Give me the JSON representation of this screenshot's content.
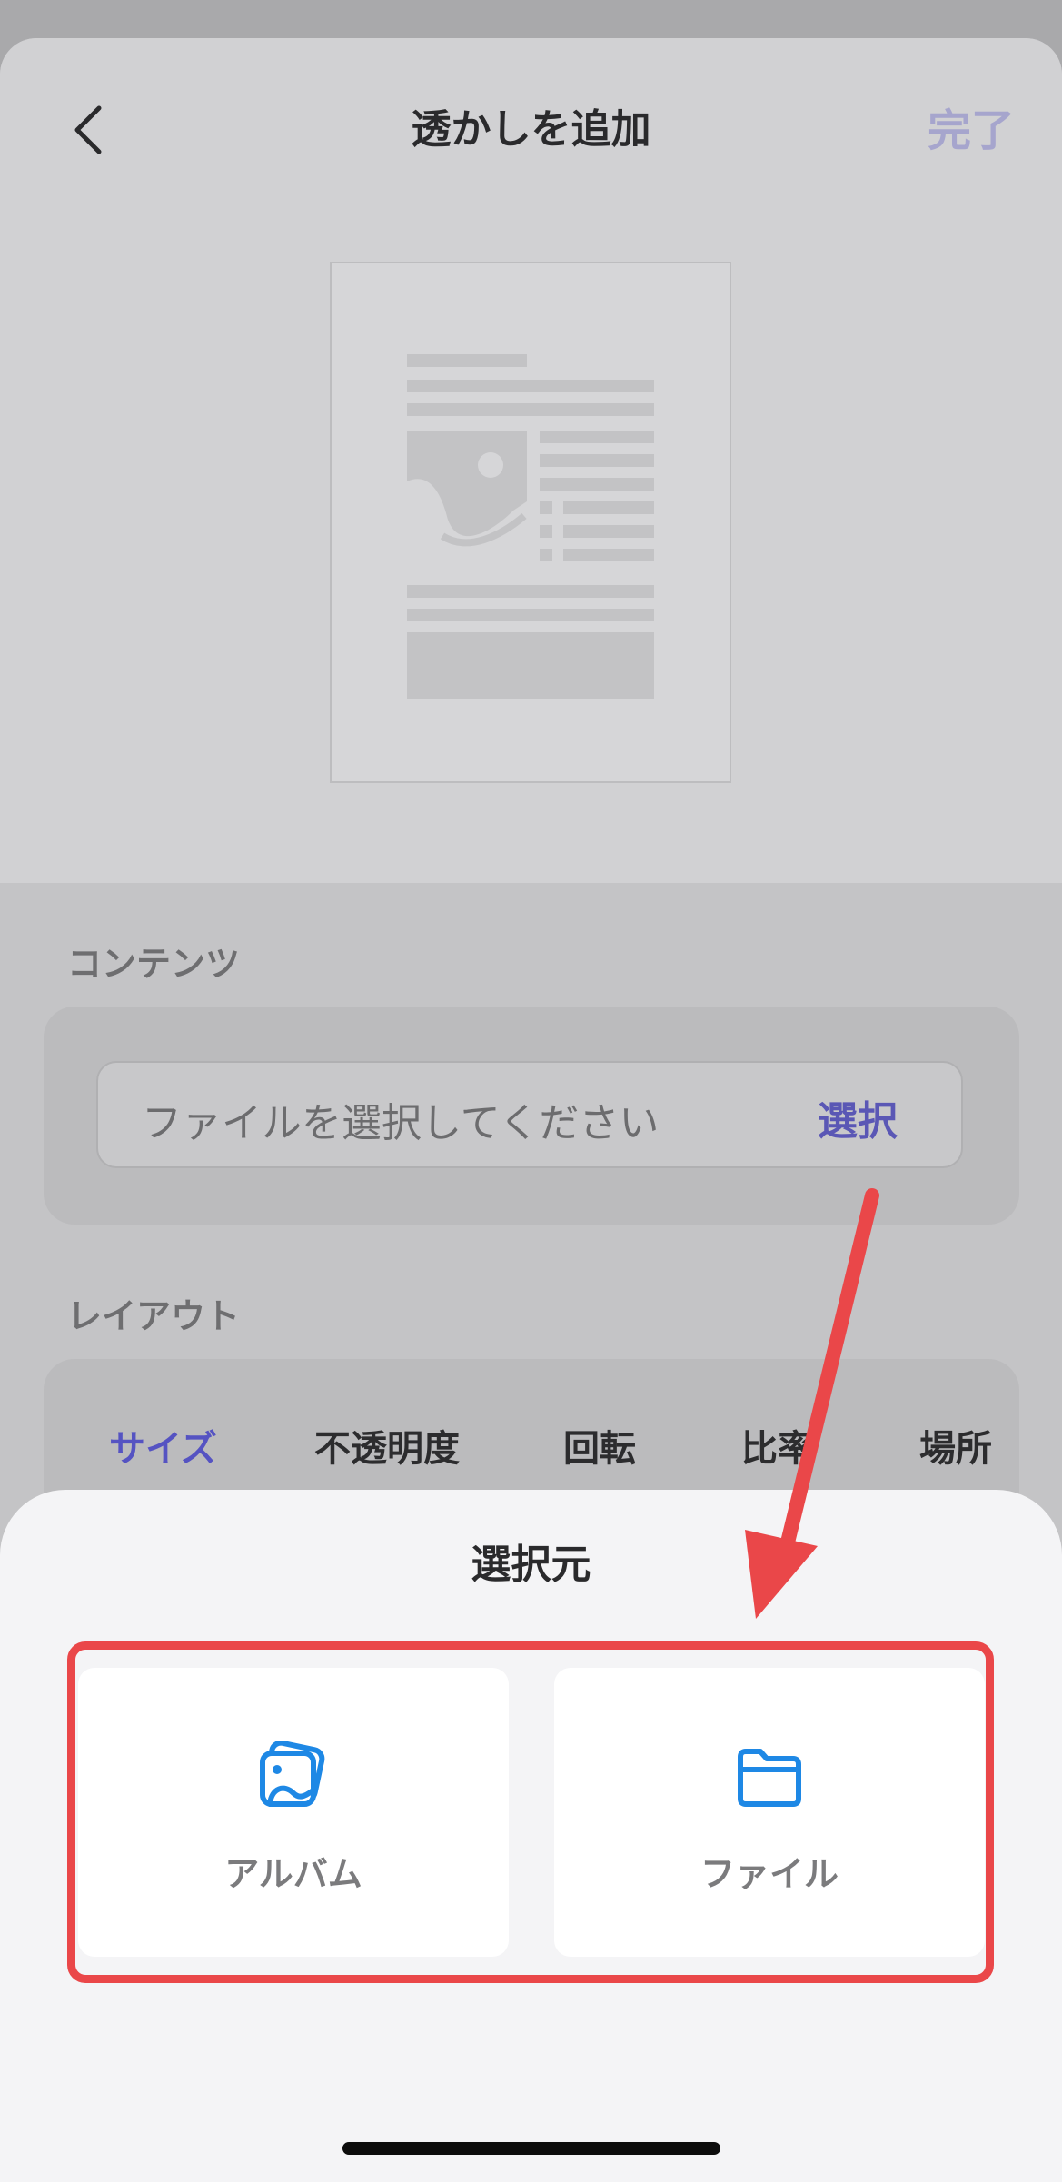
{
  "header": {
    "title": "透かしを追加",
    "done_label": "完了"
  },
  "content_section": {
    "label": "コンテンツ",
    "file_placeholder": "ファイルを選択してください",
    "select_label": "選択"
  },
  "layout_section": {
    "label": "レイアウト",
    "tabs": [
      {
        "label": "サイズ",
        "active": true
      },
      {
        "label": "不透明度",
        "active": false
      },
      {
        "label": "回転",
        "active": false
      },
      {
        "label": "比率",
        "active": false
      },
      {
        "label": "場所",
        "active": false
      }
    ]
  },
  "source_sheet": {
    "title": "選択元",
    "options": [
      {
        "label": "アルバム",
        "icon": "album-icon"
      },
      {
        "label": "ファイル",
        "icon": "folder-icon"
      }
    ]
  },
  "colors": {
    "accent": "#5553c2",
    "icon_blue": "#1e88e5",
    "annotation_red": "#ea4749"
  }
}
